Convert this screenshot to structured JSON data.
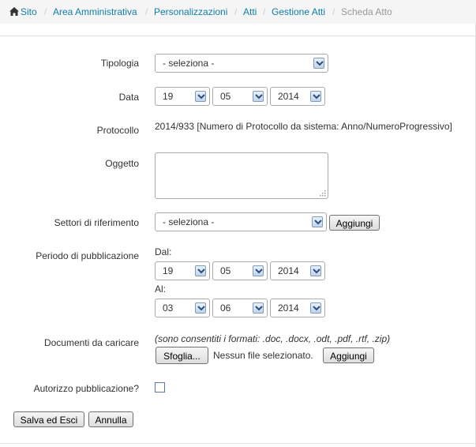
{
  "breadcrumb": {
    "items": [
      "Sito",
      "Area Amministrativa",
      "Personalizzazioni",
      "Atti",
      "Gestione Atti",
      "Scheda Atto"
    ],
    "separator": "/"
  },
  "form": {
    "tipologia": {
      "label": "Tipologia",
      "value": "- seleziona -"
    },
    "data": {
      "label": "Data",
      "day": "19",
      "month": "05",
      "year": "2014"
    },
    "protocollo": {
      "label": "Protocollo",
      "value": "2014/933 [Numero di Protocollo da sistema: Anno/NumeroProgressivo]"
    },
    "oggetto": {
      "label": "Oggetto",
      "value": ""
    },
    "settori": {
      "label": "Settori di riferimento",
      "value": "- seleziona -",
      "add_label": "Aggiungi"
    },
    "periodo": {
      "label": "Periodo di pubblicazione",
      "dal_label": "Dal:",
      "dal": {
        "day": "19",
        "month": "05",
        "year": "2014"
      },
      "al_label": "Al:",
      "al": {
        "day": "03",
        "month": "06",
        "year": "2014"
      }
    },
    "documenti": {
      "label": "Documenti da caricare",
      "hint": "(sono consentiti i formati: .doc, .docx, .odt, .pdf, .rtf, .zip)",
      "browse_label": "Sfoglia...",
      "no_file": "Nessun file selezionato.",
      "add_label": "Aggiungi"
    },
    "autorizzo": {
      "label": "Autorizzo pubblicazione?",
      "checked": false
    }
  },
  "actions": {
    "save_label": "Salva ed Esci",
    "cancel_label": "Annulla"
  },
  "colors": {
    "link": "#0f7fa8",
    "current": "#999999",
    "border": "#aaaaaa"
  }
}
